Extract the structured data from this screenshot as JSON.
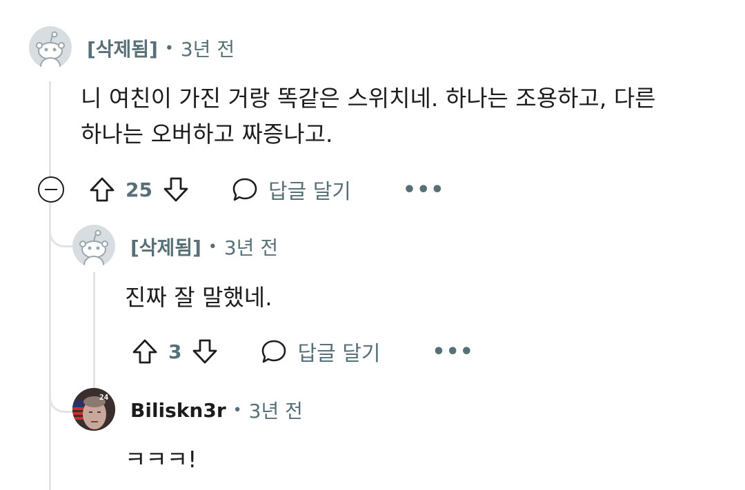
{
  "comments": [
    {
      "author": "[삭제됨]",
      "separator": "•",
      "time": "3년 전",
      "body": "니 여친이 가진 거랑 똑같은 스위치네. 하나는 조용하고, 다른\n하나는 오버하고 짜증나고.",
      "score": "25",
      "reply_label": "답글 달기",
      "more_label": "•••"
    },
    {
      "author": "[삭제됨]",
      "separator": "•",
      "time": "3년 전",
      "body": "진짜 잘 말했네.",
      "score": "3",
      "reply_label": "답글 달기",
      "more_label": "•••"
    },
    {
      "author": "Biliskn3r",
      "separator": "•",
      "time": "3년 전",
      "body": "ㅋㅋㅋ!",
      "avatar_badge": "24"
    }
  ],
  "colors": {
    "meta": "#576f76",
    "text": "#1c1c1c",
    "thread_line": "#e3e3e3"
  },
  "icons": [
    "upvote-icon",
    "downvote-icon",
    "comment-bubble-icon",
    "collapse-icon",
    "snoo-avatar-icon"
  ]
}
